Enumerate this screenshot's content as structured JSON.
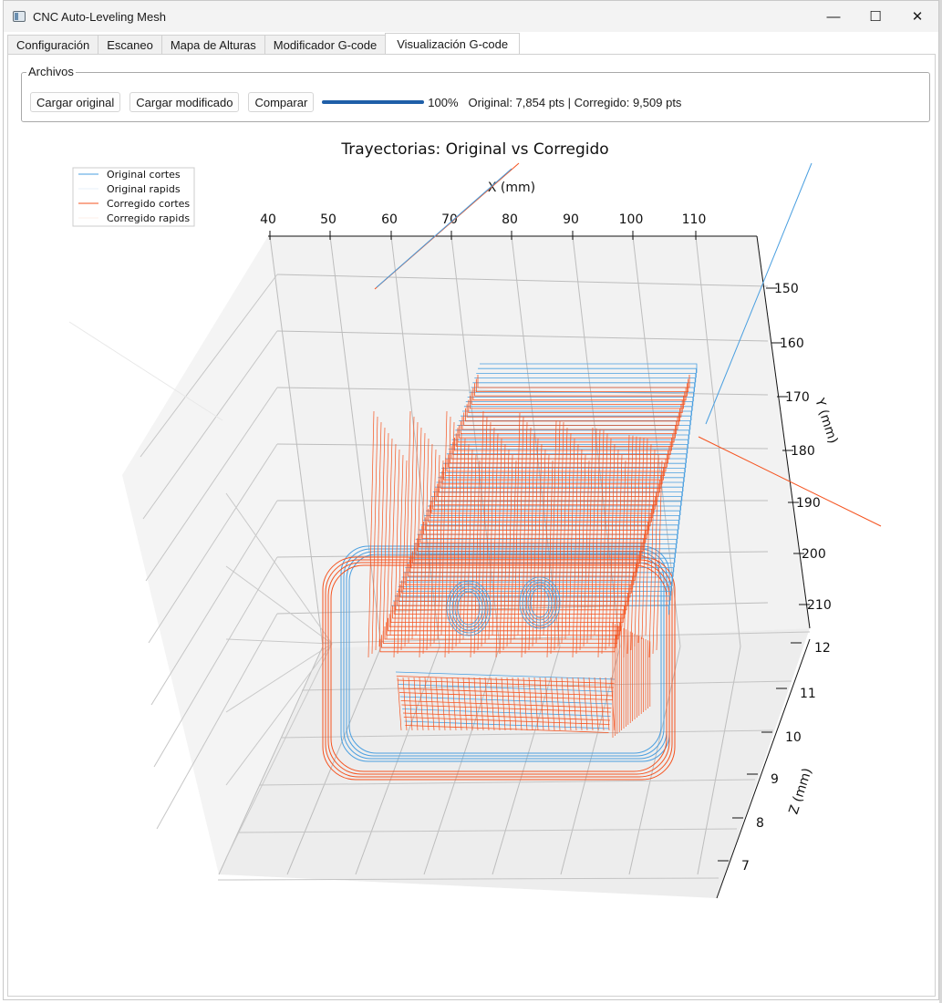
{
  "window": {
    "title": "CNC Auto-Leveling Mesh",
    "minimize_glyph": "—",
    "maximize_glyph": "☐",
    "close_glyph": "✕"
  },
  "tabs": [
    {
      "label": "Configuración"
    },
    {
      "label": "Escaneo"
    },
    {
      "label": "Mapa de Alturas"
    },
    {
      "label": "Modificador G-code"
    },
    {
      "label": "Visualización G-code"
    }
  ],
  "active_tab": "Visualización G-code",
  "files_group": {
    "legend": "Archivos",
    "load_original": "Cargar original",
    "load_modified": "Cargar modificado",
    "compare": "Comparar",
    "progress_value": 1.0,
    "progress_text": "100%",
    "status_text": "Original: 7,854 pts | Corregido: 9,509 pts"
  },
  "colors": {
    "original": "#4a9fe0",
    "corrected": "#f5531f",
    "accent": "#1f5fa8"
  },
  "chart_data": {
    "type": "line",
    "projection": "3d",
    "title": "Trayectorias: Original vs Corregido",
    "xlabel": "X (mm)",
    "ylabel": "Y (mm)",
    "zlabel": "Z (mm)",
    "x_ticks": [
      "40",
      "50",
      "60",
      "70",
      "80",
      "90",
      "100",
      "110"
    ],
    "y_ticks": [
      "150",
      "160",
      "170",
      "180",
      "190",
      "200",
      "210"
    ],
    "z_ticks": [
      "12",
      "11",
      "10",
      "9",
      "8",
      "7"
    ],
    "legend_position": "upper-left",
    "grid": true,
    "series": [
      {
        "name": "Original cortes",
        "color": "#4a9fe0"
      },
      {
        "name": "Original rapids",
        "color": "#cfe3f4"
      },
      {
        "name": "Corregido cortes",
        "color": "#f5531f"
      },
      {
        "name": "Corregido rapids",
        "color": "#fde0d4"
      }
    ]
  }
}
